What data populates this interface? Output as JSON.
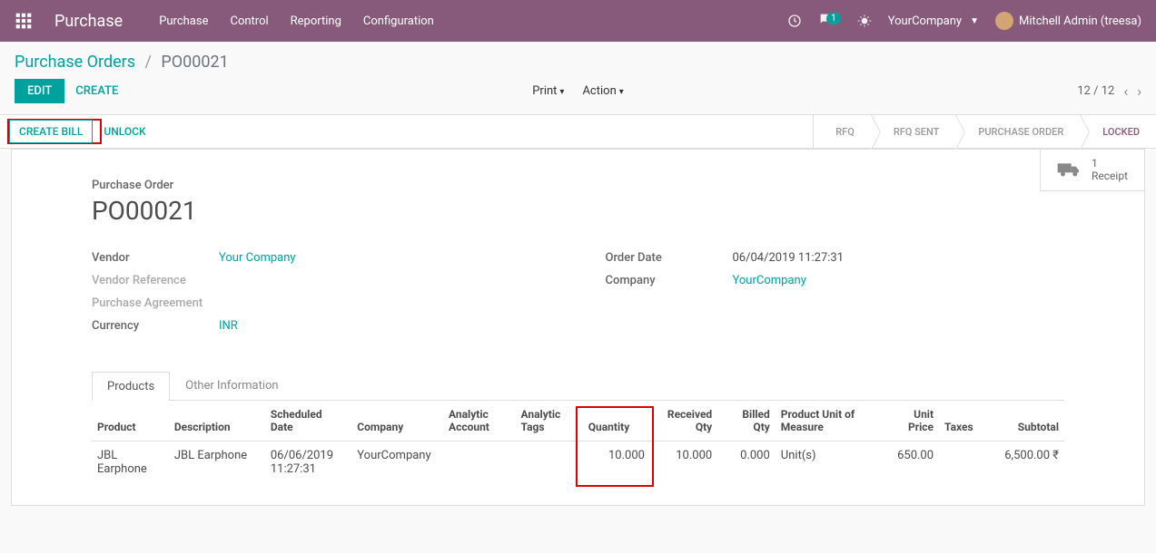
{
  "header": {
    "app_title": "Purchase",
    "menu": [
      "Purchase",
      "Control",
      "Reporting",
      "Configuration"
    ],
    "msg_count": "1",
    "company_name": "YourCompany",
    "user_name": "Mitchell Admin (treesa)"
  },
  "breadcrumbs": {
    "root": "Purchase Orders",
    "current": "PO00021"
  },
  "buttons": {
    "edit": "EDIT",
    "create": "CREATE",
    "print": "Print",
    "action": "Action",
    "create_bill": "CREATE BILL",
    "unlock": "UNLOCK"
  },
  "pager": {
    "text": "12 / 12"
  },
  "status_steps": [
    "RFQ",
    "RFQ SENT",
    "PURCHASE ORDER",
    "LOCKED"
  ],
  "stat_button": {
    "count": "1",
    "label": "Receipt"
  },
  "po": {
    "label": "Purchase Order",
    "number": "PO00021",
    "left": [
      {
        "label": "Vendor",
        "value": "Your Company",
        "link": true
      },
      {
        "label": "Vendor Reference",
        "value": "",
        "muted": true
      },
      {
        "label": "Purchase Agreement",
        "value": "",
        "muted": true
      },
      {
        "label": "Currency",
        "value": "INR",
        "link": true
      }
    ],
    "right": [
      {
        "label": "Order Date",
        "value": "06/04/2019 11:27:31"
      },
      {
        "label": "Company",
        "value": "YourCompany",
        "link": true
      }
    ]
  },
  "tabs": [
    "Products",
    "Other Information"
  ],
  "table": {
    "headers": [
      "Product",
      "Description",
      "Scheduled Date",
      "Company",
      "Analytic Account",
      "Analytic Tags",
      "Quantity",
      "Received Qty",
      "Billed Qty",
      "Product Unit of Measure",
      "Unit Price",
      "Taxes",
      "Subtotal"
    ],
    "rows": [
      {
        "product": "JBL Earphone",
        "description": "JBL Earphone",
        "scheduled_date": "06/06/2019 11:27:31",
        "company": "YourCompany",
        "analytic_account": "",
        "analytic_tags": "",
        "quantity": "10.000",
        "received_qty": "10.000",
        "billed_qty": "0.000",
        "uom": "Unit(s)",
        "unit_price": "650.00",
        "taxes": "",
        "subtotal": "6,500.00 ₹"
      }
    ]
  }
}
